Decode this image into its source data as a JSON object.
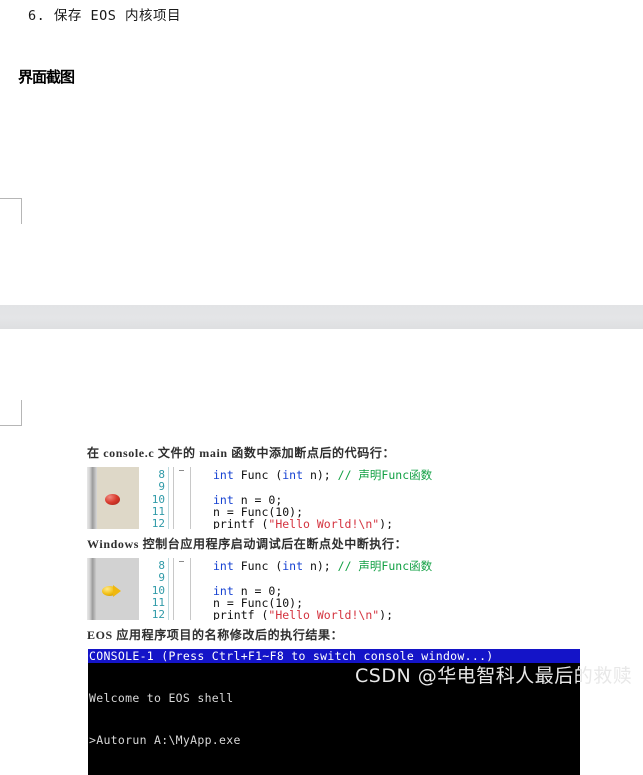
{
  "document": {
    "list_item": "6. 保存 EOS 内核项目",
    "section_heading": "界面截图"
  },
  "figures": [
    {
      "caption": "在 console.c 文件的 main 函数中添加断点后的代码行：",
      "marker": "breakpoint",
      "line_numbers": [
        "8",
        "9",
        "10",
        "11",
        "12"
      ],
      "code": [
        {
          "tokens": [
            {
              "t": "int",
              "c": "kw"
            },
            {
              "t": " Func (",
              "c": "plain"
            },
            {
              "t": "int",
              "c": "kw"
            },
            {
              "t": " n); ",
              "c": "plain"
            },
            {
              "t": "// 声明Func函数",
              "c": "comment"
            }
          ]
        },
        {
          "tokens": [
            {
              "t": " ",
              "c": "blank"
            }
          ]
        },
        {
          "tokens": [
            {
              "t": "int",
              "c": "kw"
            },
            {
              "t": " n = 0;",
              "c": "plain"
            }
          ]
        },
        {
          "tokens": [
            {
              "t": "n = Func(10);",
              "c": "plain"
            }
          ]
        },
        {
          "tokens": [
            {
              "t": "printf (",
              "c": "plain"
            },
            {
              "t": "\"Hello World!\\n\"",
              "c": "string"
            },
            {
              "t": ");",
              "c": "plain"
            }
          ]
        }
      ]
    },
    {
      "caption": "Windows 控制台应用程序启动调试后在断点处中断执行：",
      "marker": "current-statement-arrow",
      "line_numbers": [
        "8",
        "9",
        "10",
        "11",
        "12"
      ],
      "code": [
        {
          "tokens": [
            {
              "t": "int",
              "c": "kw"
            },
            {
              "t": " Func (",
              "c": "plain"
            },
            {
              "t": "int",
              "c": "kw"
            },
            {
              "t": " n); ",
              "c": "plain"
            },
            {
              "t": "// 声明Func函数",
              "c": "comment"
            }
          ]
        },
        {
          "tokens": [
            {
              "t": " ",
              "c": "blank"
            }
          ]
        },
        {
          "tokens": [
            {
              "t": "int",
              "c": "kw"
            },
            {
              "t": " n = 0;",
              "c": "plain"
            }
          ]
        },
        {
          "tokens": [
            {
              "t": "n = Func(10);",
              "c": "plain"
            }
          ]
        },
        {
          "tokens": [
            {
              "t": "printf (",
              "c": "plain"
            },
            {
              "t": "\"Hello World!\\n\"",
              "c": "string"
            },
            {
              "t": ");",
              "c": "plain"
            }
          ]
        }
      ]
    }
  ],
  "console_caption": "EOS 应用程序项目的名称修改后的执行结果：",
  "console": {
    "titlebar": "CONSOLE-1 (Press Ctrl+F1~F8 to switch console window...)",
    "lines": [
      "Welcome to EOS shell",
      ">Autorun A:\\MyApp.exe"
    ]
  },
  "watermark": "CSDN @华电智科人最后的救赎",
  "colors": {
    "keyword": "#1642d2",
    "comment": "#12a044",
    "string": "#d4333f",
    "line_number": "#2f9aa8",
    "console_titlebar": "#1414c8",
    "breakpoint": "#d93b2e",
    "arrow": "#f2c014",
    "gray_band": "#e2e3e5"
  }
}
